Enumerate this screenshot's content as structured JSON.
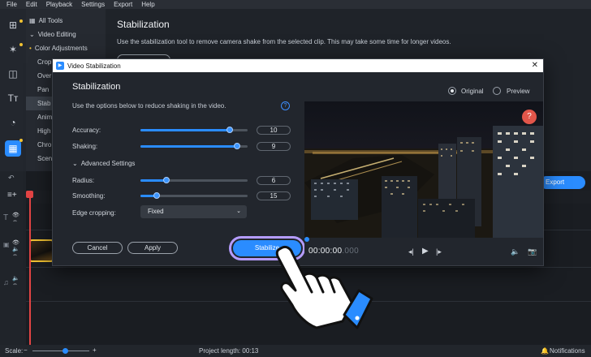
{
  "menubar": [
    "File",
    "Edit",
    "Playback",
    "Settings",
    "Export",
    "Help"
  ],
  "tools": [
    {
      "label": "All Tools",
      "prefix": "▦",
      "selected": false
    },
    {
      "label": "Video Editing",
      "prefix": "⌄",
      "selected": false
    },
    {
      "label": "Color Adjustments",
      "prefix": "•",
      "selected": false
    },
    {
      "label": "Crop",
      "prefix": "",
      "selected": false
    },
    {
      "label": "Over",
      "prefix": "",
      "selected": false
    },
    {
      "label": "Pan",
      "prefix": "",
      "selected": false
    },
    {
      "label": "Stab",
      "prefix": "",
      "selected": true
    },
    {
      "label": "Anim",
      "prefix": "",
      "selected": false
    },
    {
      "label": "High",
      "prefix": "",
      "selected": false
    },
    {
      "label": "Chro",
      "prefix": "",
      "selected": false
    },
    {
      "label": "Scen",
      "prefix": "",
      "selected": false
    }
  ],
  "panel": {
    "title": "Stabilization",
    "description": "Use the stabilization tool to remove camera shake from the selected clip. This may take some time for longer videos."
  },
  "dialog": {
    "window_title": "Video Stabilization",
    "close_glyph": "✕",
    "heading": "Stabilization",
    "hint": "Use the options below to reduce shaking in the video.",
    "help_glyph": "?",
    "view_options": [
      "Original",
      "Preview"
    ],
    "view_selected": "Original",
    "sliders": [
      {
        "label": "Accuracy",
        "value": 10,
        "max": 12
      },
      {
        "label": "Shaking",
        "value": 9,
        "max": 10
      }
    ],
    "advanced_label": "Advanced Settings",
    "advanced_sliders": [
      {
        "label": "Radius",
        "value": 6,
        "max": 25
      },
      {
        "label": "Smoothing",
        "value": 15,
        "max": 100
      }
    ],
    "edge_cropping_label": "Edge cropping:",
    "edge_cropping_value": "Fixed",
    "cancel_label": "Cancel",
    "apply_label": "Apply",
    "stabilize_label": "Stabilize"
  },
  "player": {
    "timecode_main": "00:00:00",
    "timecode_ms": ".000",
    "help_glyph": "?"
  },
  "export_label": "Export",
  "status": {
    "scale_label": "Scale:",
    "project_length": "Project length:  00:13",
    "notifications": "Notifications"
  },
  "colors": {
    "accent": "#2a8cff",
    "highlight_ring": "#b59cff",
    "selected_clip_border": "#f1c232",
    "playhead": "#e24444"
  }
}
